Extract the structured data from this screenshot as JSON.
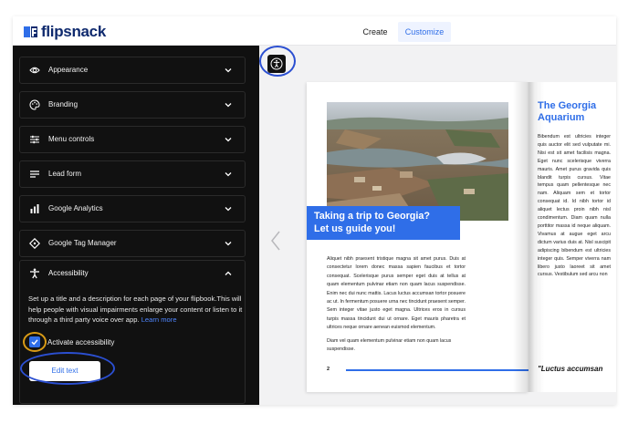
{
  "app": {
    "logo_text": "flipsnack",
    "nav": {
      "create": "Create",
      "customize": "Customize"
    }
  },
  "sidebar": {
    "sections": [
      {
        "label": "Appearance",
        "icon": "eye-icon"
      },
      {
        "label": "Branding",
        "icon": "palette-icon"
      },
      {
        "label": "Menu controls",
        "icon": "sliders-icon"
      },
      {
        "label": "Lead form",
        "icon": "form-lines-icon"
      },
      {
        "label": "Google Analytics",
        "icon": "bar-chart-icon"
      },
      {
        "label": "Google Tag Manager",
        "icon": "tag-icon"
      }
    ],
    "accessibility": {
      "label": "Accessibility",
      "icon": "accessibility-person-icon",
      "description": "Set up a title and a description for each page of your flipbook.This will help people with visual impairments enlarge your content or listen to it through a third party voice over app.",
      "learn_more": "Learn more",
      "checkbox_label": "Activate accessibility",
      "checked": true,
      "edit_button": "Edit text"
    }
  },
  "colors": {
    "accent": "#2f6ee8",
    "sidebar_bg": "#101010",
    "highlight_ring_blue": "#2b4fd1",
    "highlight_ring_orange": "#d89a16"
  },
  "book": {
    "left_page": {
      "headline_line1": "Taking a trip to Georgia?",
      "headline_line2": "Let us guide you!",
      "body1": "Aliquet nibh praesent tristique magna sit amet purus. Duis at consectetur lorem donec massa sapien faucibus et tortor consequat. Scelerisque purus semper eget duis at tellus at quam elementum pulvinar etiam non quam lacus suspendisse. Enim nec dui nunc mattis. Lacus luctus accumsan tortor posuere ac ut. In fermentum posuere urna nec tincidunt praesent semper. Sem integer vitae justo eget magna. Ultrices eros in cursus turpis massa tincidunt dui ut ornare. Eget mauris pharetra et ultrices neque ornare aenean euismod elementum.",
      "body2": "Diam vel quam elementum pulvinar etiam non quam lacus suspendisse.",
      "page_number": "2"
    },
    "right_page": {
      "title_line1": "The Georgia",
      "title_line2": "Aquarium",
      "body": "Bibendum est ultricies integer quis auctor elit sed vulputate mi. Nisi est sit amet facilisis magna. Eget nunc scelerisque viverra mauris. Amet purus gravida quis blandit turpis cursus. Vitae tempus quam pellentesque nec nam. Aliquam sem et tortor consequat id. Id nibh tortor id aliquet lectus proin nibh nisl condimentum. Diam quam nulla porttitor massa id neque aliquam. Vivamus at augue eget arcu dictum varius duis at. Nisl suscipit adipiscing bibendum est ultricies integer quis. Semper viverra nam libero justo laoreet sit amet cursus. Vestibulum sed arcu non",
      "quote": "\"Luctus accumsan"
    }
  }
}
